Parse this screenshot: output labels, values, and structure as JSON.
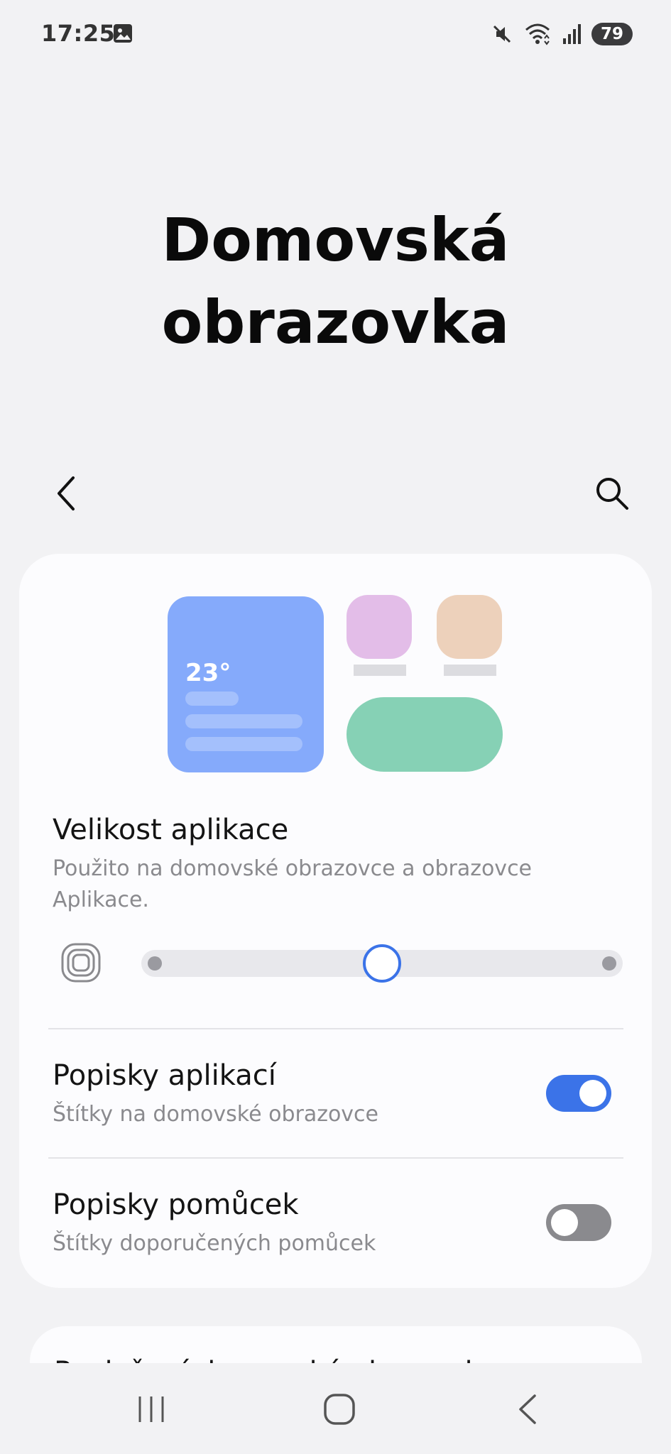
{
  "status_bar": {
    "time": "17:25",
    "battery": "79",
    "icons": [
      "gallery-icon",
      "mute-icon",
      "wifi-icon",
      "signal-icon"
    ]
  },
  "page": {
    "title_line1": "Domovská",
    "title_line2": "obrazovka"
  },
  "preview": {
    "widget_temp": "23°"
  },
  "app_size": {
    "title": "Velikost aplikace",
    "subtitle_line1": "Použito na domovské obrazovce a obrazovce",
    "subtitle_line2": "Aplikace.",
    "slider_value": 0.5
  },
  "app_labels": {
    "title": "Popisky aplikací",
    "subtitle": "Štítky na domovské obrazovce",
    "enabled": true
  },
  "widget_labels": {
    "title": "Popisky pomůcek",
    "subtitle": "Štítky doporučených pomůcek",
    "enabled": false
  },
  "next_item": {
    "title": "Rozložení domovské obrazovky"
  },
  "colors": {
    "accent": "#3b73e8",
    "background": "#f2f2f4",
    "card": "#fcfcfe",
    "widget_blue": "#85aafb",
    "app_pink": "#e3bde8",
    "app_peach": "#edd1bb",
    "pill_green": "#86d1b5"
  }
}
